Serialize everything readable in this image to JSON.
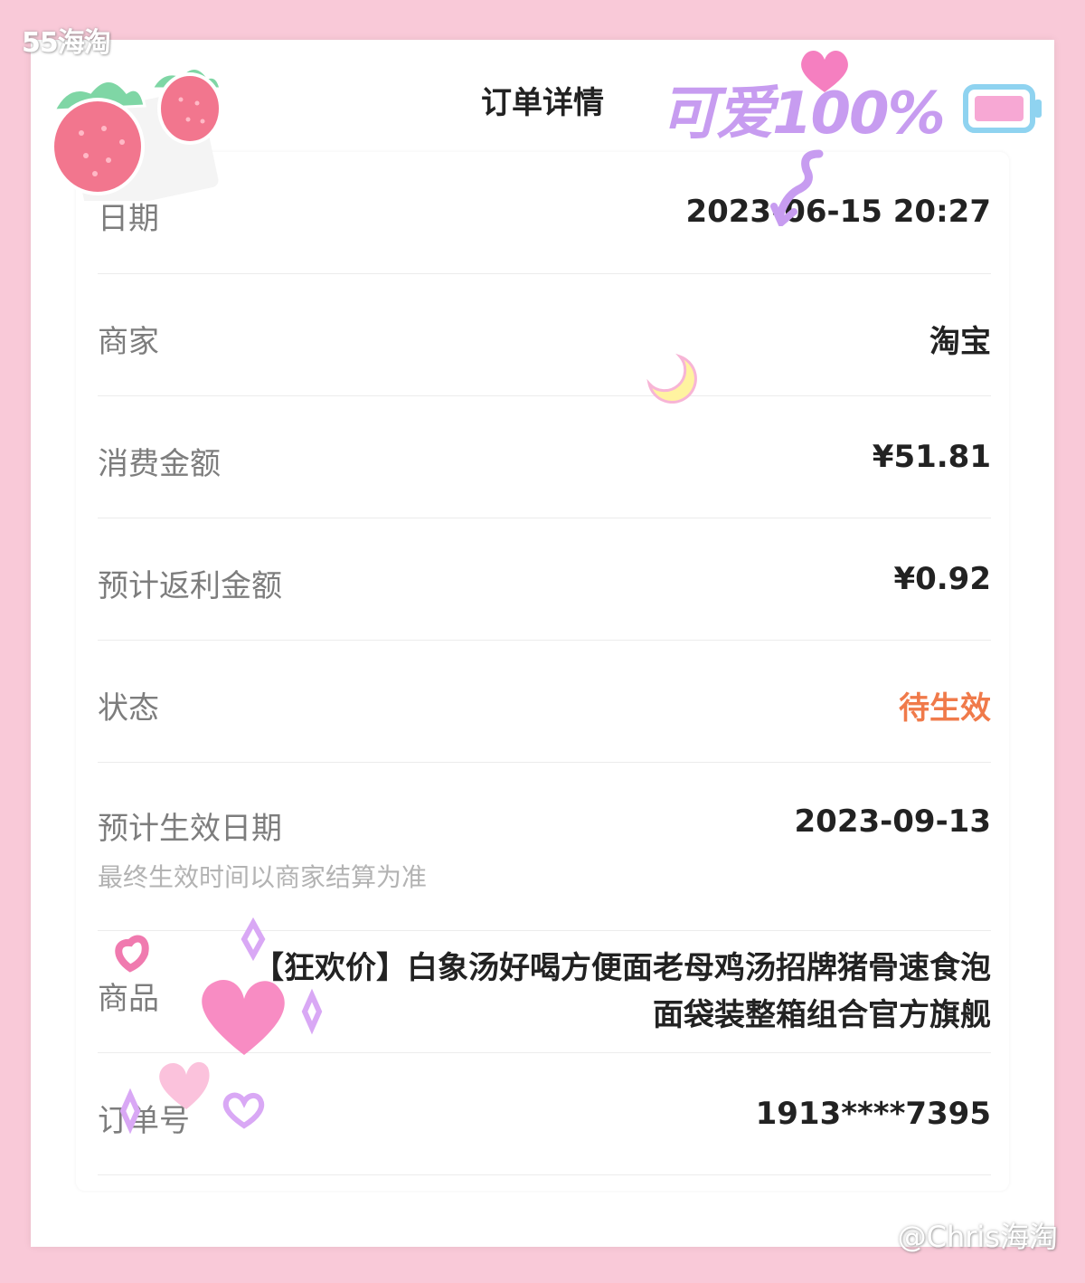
{
  "watermarks": {
    "top_left": "55海淘",
    "bottom_right": "@Chris海淘"
  },
  "page": {
    "title": "订单详情"
  },
  "stickers": {
    "decorative_text": "可爱100%"
  },
  "order": {
    "date": {
      "label": "日期",
      "value": "2023-06-15 20:27"
    },
    "merchant": {
      "label": "商家",
      "value": "淘宝"
    },
    "amount": {
      "label": "消费金额",
      "value": "¥51.81"
    },
    "rebate": {
      "label": "预计返利金额",
      "value": "¥0.92"
    },
    "status": {
      "label": "状态",
      "value": "待生效"
    },
    "effective_date": {
      "label": "预计生效日期",
      "value": "2023-09-13",
      "note": "最终生效时间以商家结算为准"
    },
    "product": {
      "label": "商品",
      "value": "【狂欢价】白象汤好喝方便面老母鸡汤招牌猪骨速食泡面袋装整箱组合官方旗舰"
    },
    "order_no": {
      "label": "订单号",
      "value": "1913****7395"
    }
  },
  "colors": {
    "background": "#f9c9d8",
    "status_pending": "#f07a4a",
    "label": "#7d7d7d",
    "value": "#222222"
  }
}
